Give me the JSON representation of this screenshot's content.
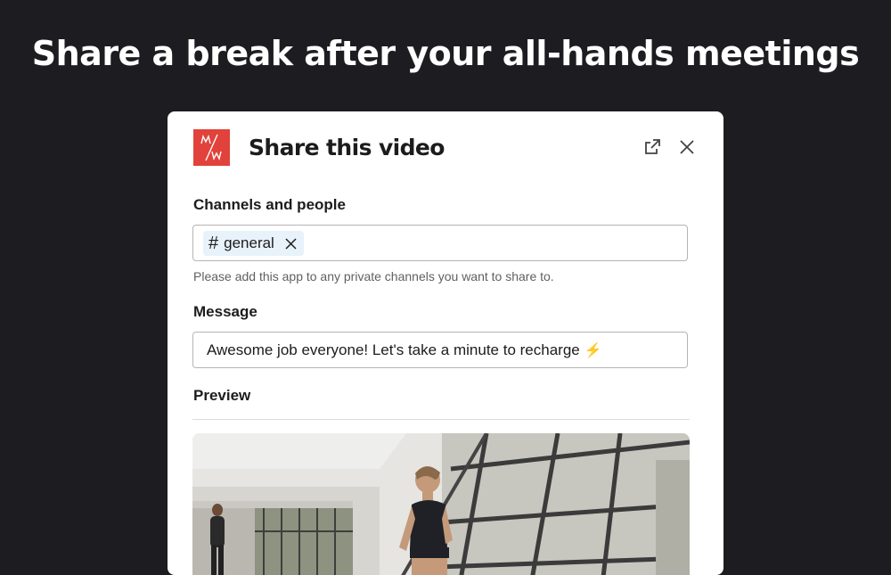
{
  "headline": "Share a break after your all-hands meetings",
  "modal": {
    "logo_text": "M/W",
    "title": "Share this video",
    "icons": {
      "open_external": "external-link-icon",
      "close": "close-icon"
    }
  },
  "channels": {
    "label": "Channels and people",
    "chip": {
      "prefix": "#",
      "name": "general"
    },
    "hint": "Please add this app to any private channels you want to share to."
  },
  "message": {
    "label": "Message",
    "value": "Awesome job everyone! Let's take a minute to recharge",
    "emoji": "⚡"
  },
  "preview": {
    "label": "Preview"
  },
  "colors": {
    "background": "#1d1c21",
    "logo": "#e1423b",
    "chip_bg": "#e8f2fa"
  }
}
